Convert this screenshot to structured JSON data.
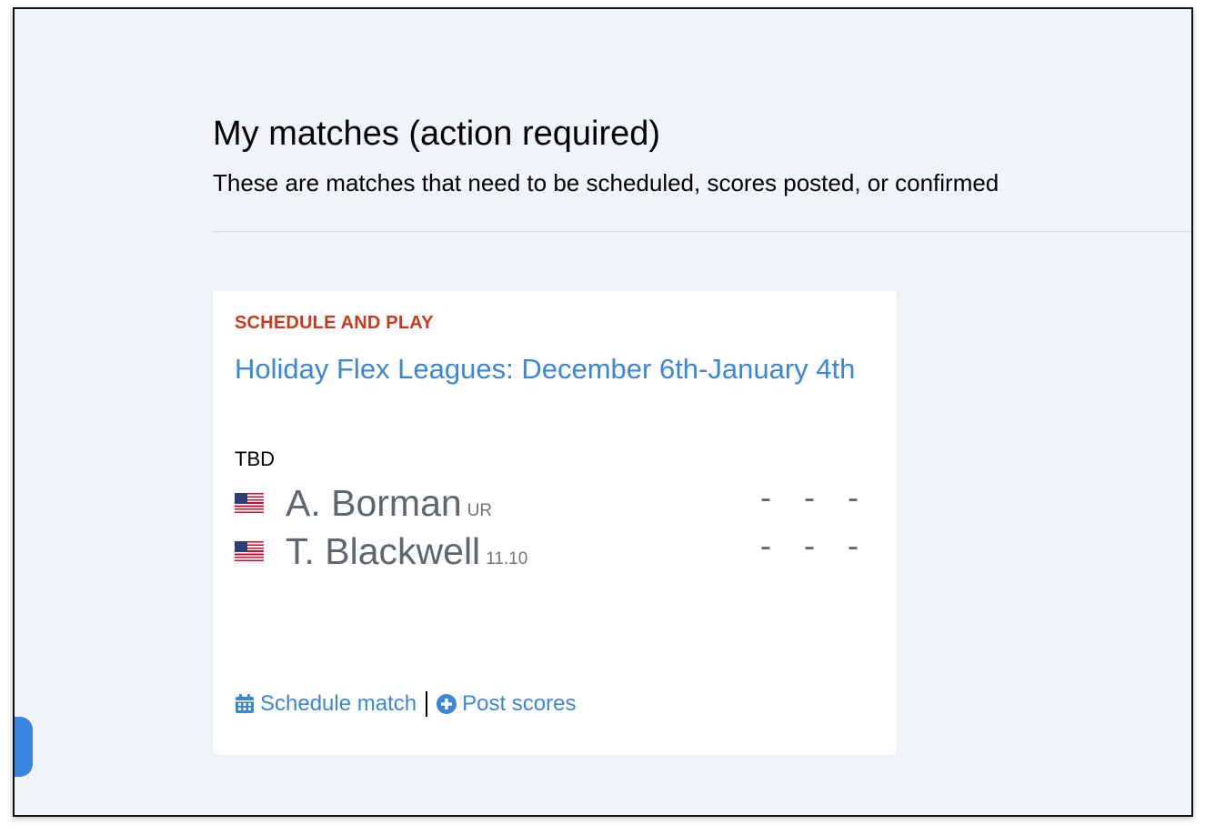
{
  "page": {
    "title": "My matches (action required)",
    "subtitle": "These are matches that need to be scheduled, scores posted, or confirmed"
  },
  "match_card": {
    "status": "SCHEDULE AND PLAY",
    "league": "Holiday Flex Leagues: December 6th-January 4th",
    "time": "TBD",
    "players": [
      {
        "name": "A. Borman",
        "rating": "UR",
        "flag": "us-flag-icon",
        "scores": [
          "-",
          "-",
          "-"
        ]
      },
      {
        "name": "T. Blackwell",
        "rating": "11.10",
        "flag": "us-flag-icon",
        "scores": [
          "-",
          "-",
          "-"
        ]
      }
    ],
    "actions": {
      "schedule_label": "Schedule match",
      "schedule_icon": "calendar-icon",
      "post_label": "Post scores",
      "post_icon": "plus-circle-icon"
    }
  },
  "colors": {
    "background": "#f0f4f9",
    "status": "#c73a1d",
    "link": "#3b87d6",
    "player_text": "#5f6670"
  }
}
